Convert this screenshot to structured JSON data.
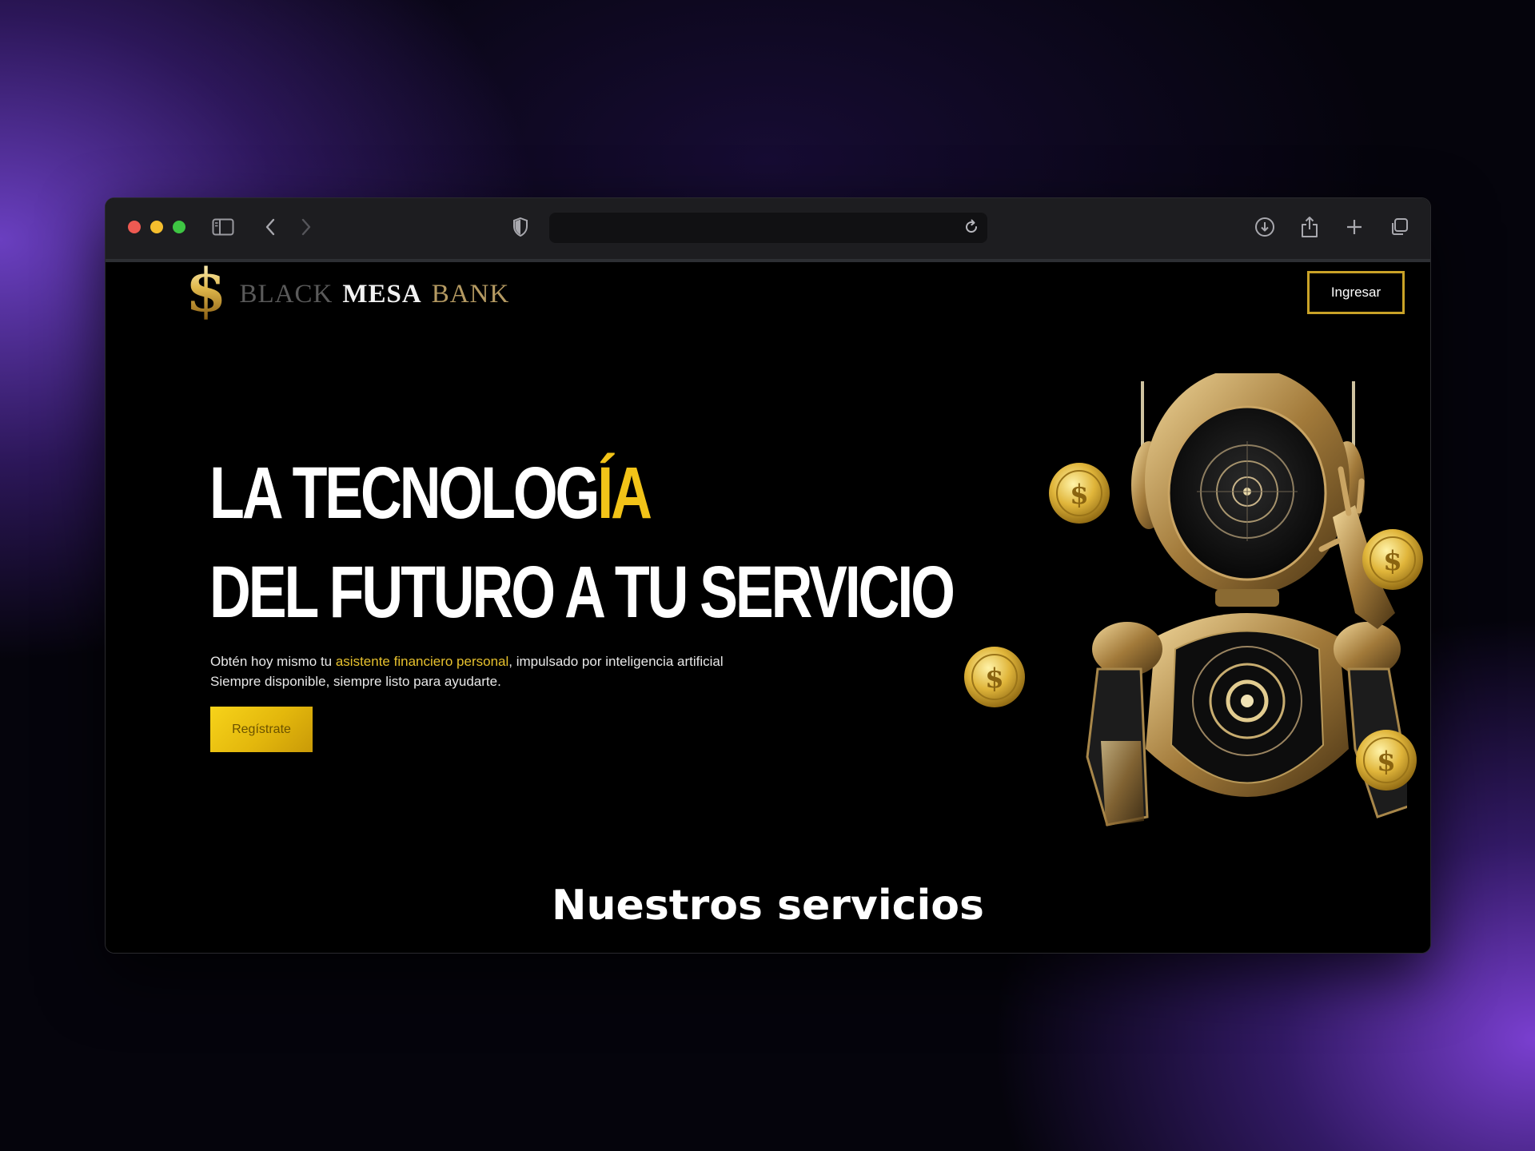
{
  "browser": {
    "address_value": "",
    "icons": [
      "sidebar-icon",
      "back-icon",
      "forward-icon",
      "privacy-shield-icon",
      "reload-icon",
      "download-icon",
      "share-icon",
      "new-tab-icon",
      "tabs-overview-icon"
    ]
  },
  "site": {
    "logo": {
      "sign": "$",
      "word1": "BLACK",
      "word2": "MESA",
      "word3": "BANK"
    },
    "login_button": "Ingresar",
    "hero": {
      "title_line1_a": "LA TECNOLOG",
      "title_line1_b": "ÍA",
      "title_line2": "DEL FUTURO A TU SERVICIO",
      "desc_a": "Obtén hoy mismo tu ",
      "desc_highlight": "asistente financiero personal",
      "desc_b": ", impulsado por inteligencia artificial",
      "desc_line2": "Siempre disponible, siempre listo para ayudarte.",
      "cta": "Regístrate"
    },
    "services_heading": "Nuestros servicios"
  },
  "colors": {
    "gold": "#f2c318",
    "button_gold": "#e3b70c",
    "page_background": "#000000",
    "toolbar": "#1d1d20"
  }
}
